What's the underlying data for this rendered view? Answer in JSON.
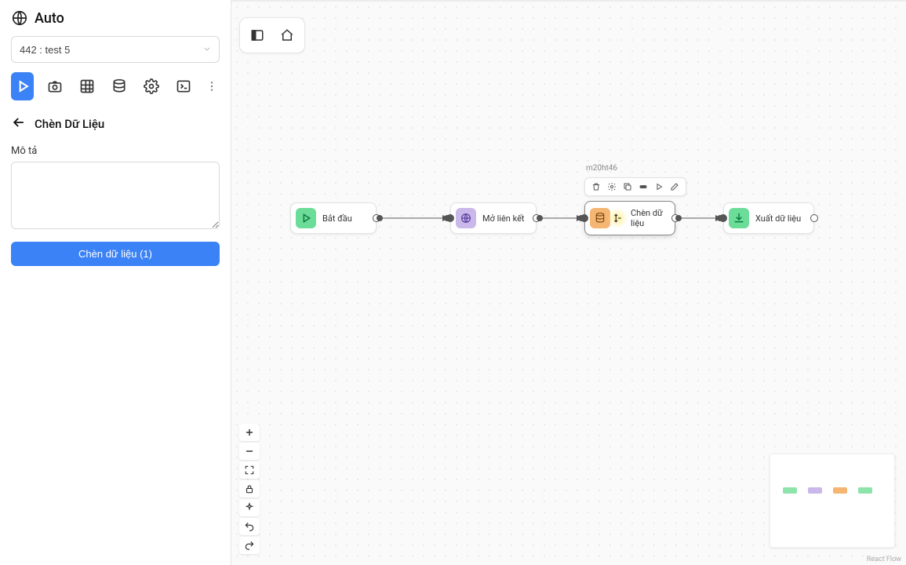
{
  "brand": {
    "title": "Auto"
  },
  "project": {
    "selected": "442 : test 5"
  },
  "panel": {
    "title": "Chèn Dữ Liệu",
    "desc_label": "Mô tả",
    "desc_value": "",
    "action_btn": "Chèn dữ liệu (1)"
  },
  "selected_node": {
    "id": "m20ht46"
  },
  "nodes": {
    "start": {
      "label": "Bắt đầu"
    },
    "openurl": {
      "label": "Mở liên kết"
    },
    "insert": {
      "label": "Chèn dữ liệu"
    },
    "export": {
      "label": "Xuất dữ liệu"
    }
  },
  "attribution": "React Flow"
}
